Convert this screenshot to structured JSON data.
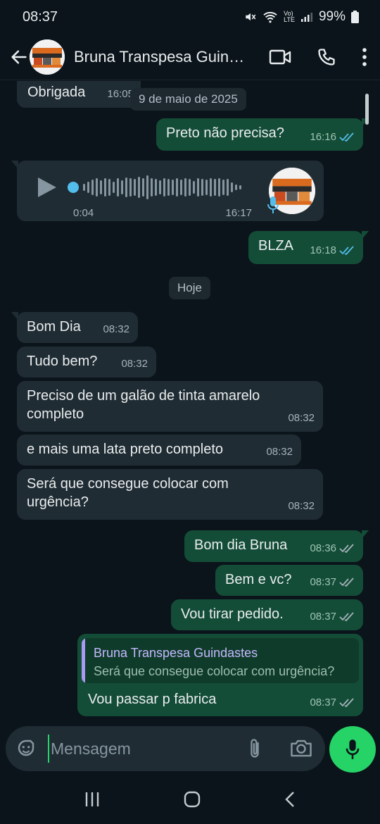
{
  "status_bar": {
    "time": "08:37",
    "battery": "99%",
    "network_top": "Vo)",
    "network_bottom": "LTE"
  },
  "header": {
    "contact_name": "Bruna Transpesa Guindastes"
  },
  "chat": {
    "date_old": "9 de maio de 2025",
    "today": "Hoje",
    "messages": [
      {
        "dir": "in",
        "text": "Obrigada",
        "time": "16:05"
      },
      {
        "dir": "out",
        "text": "Preto não precisa?",
        "time": "16:16",
        "status": "read"
      },
      {
        "dir": "in",
        "type": "audio",
        "duration": "0:04",
        "time": "16:17"
      },
      {
        "dir": "out",
        "text": "BLZA",
        "time": "16:18",
        "status": "read"
      },
      {
        "dir": "in",
        "text": "Bom Dia",
        "time": "08:32"
      },
      {
        "dir": "in",
        "text": "Tudo bem?",
        "time": "08:32"
      },
      {
        "dir": "in",
        "text": "Preciso de um galão de tinta amarelo completo",
        "time": "08:32"
      },
      {
        "dir": "in",
        "text": "e mais uma lata preto completo",
        "time": "08:32"
      },
      {
        "dir": "in",
        "text": "Será que consegue colocar com urgência?",
        "time": "08:32"
      },
      {
        "dir": "out",
        "text": "Bom dia Bruna",
        "time": "08:36",
        "status": "delivered"
      },
      {
        "dir": "out",
        "text": "Bem e vc?",
        "time": "08:37",
        "status": "delivered"
      },
      {
        "dir": "out",
        "text": "Vou tirar pedido.",
        "time": "08:37",
        "status": "delivered"
      },
      {
        "dir": "out",
        "text": "Vou passar p fabrica",
        "time": "08:37",
        "status": "delivered",
        "reply": {
          "name": "Bruna Transpesa Guindastes",
          "text": "Será que consegue colocar com urgência?"
        }
      }
    ]
  },
  "input": {
    "placeholder": "Mensagem"
  },
  "colors": {
    "incoming": "#202c33",
    "outgoing": "#144d37",
    "accent": "#25d366",
    "read_ticks": "#53bdeb"
  },
  "icons": [
    "back-arrow-icon",
    "video-call-icon",
    "phone-icon",
    "more-vert-icon",
    "play-icon",
    "mic-icon",
    "sticker-icon",
    "attach-icon",
    "camera-icon",
    "double-check-icon"
  ]
}
